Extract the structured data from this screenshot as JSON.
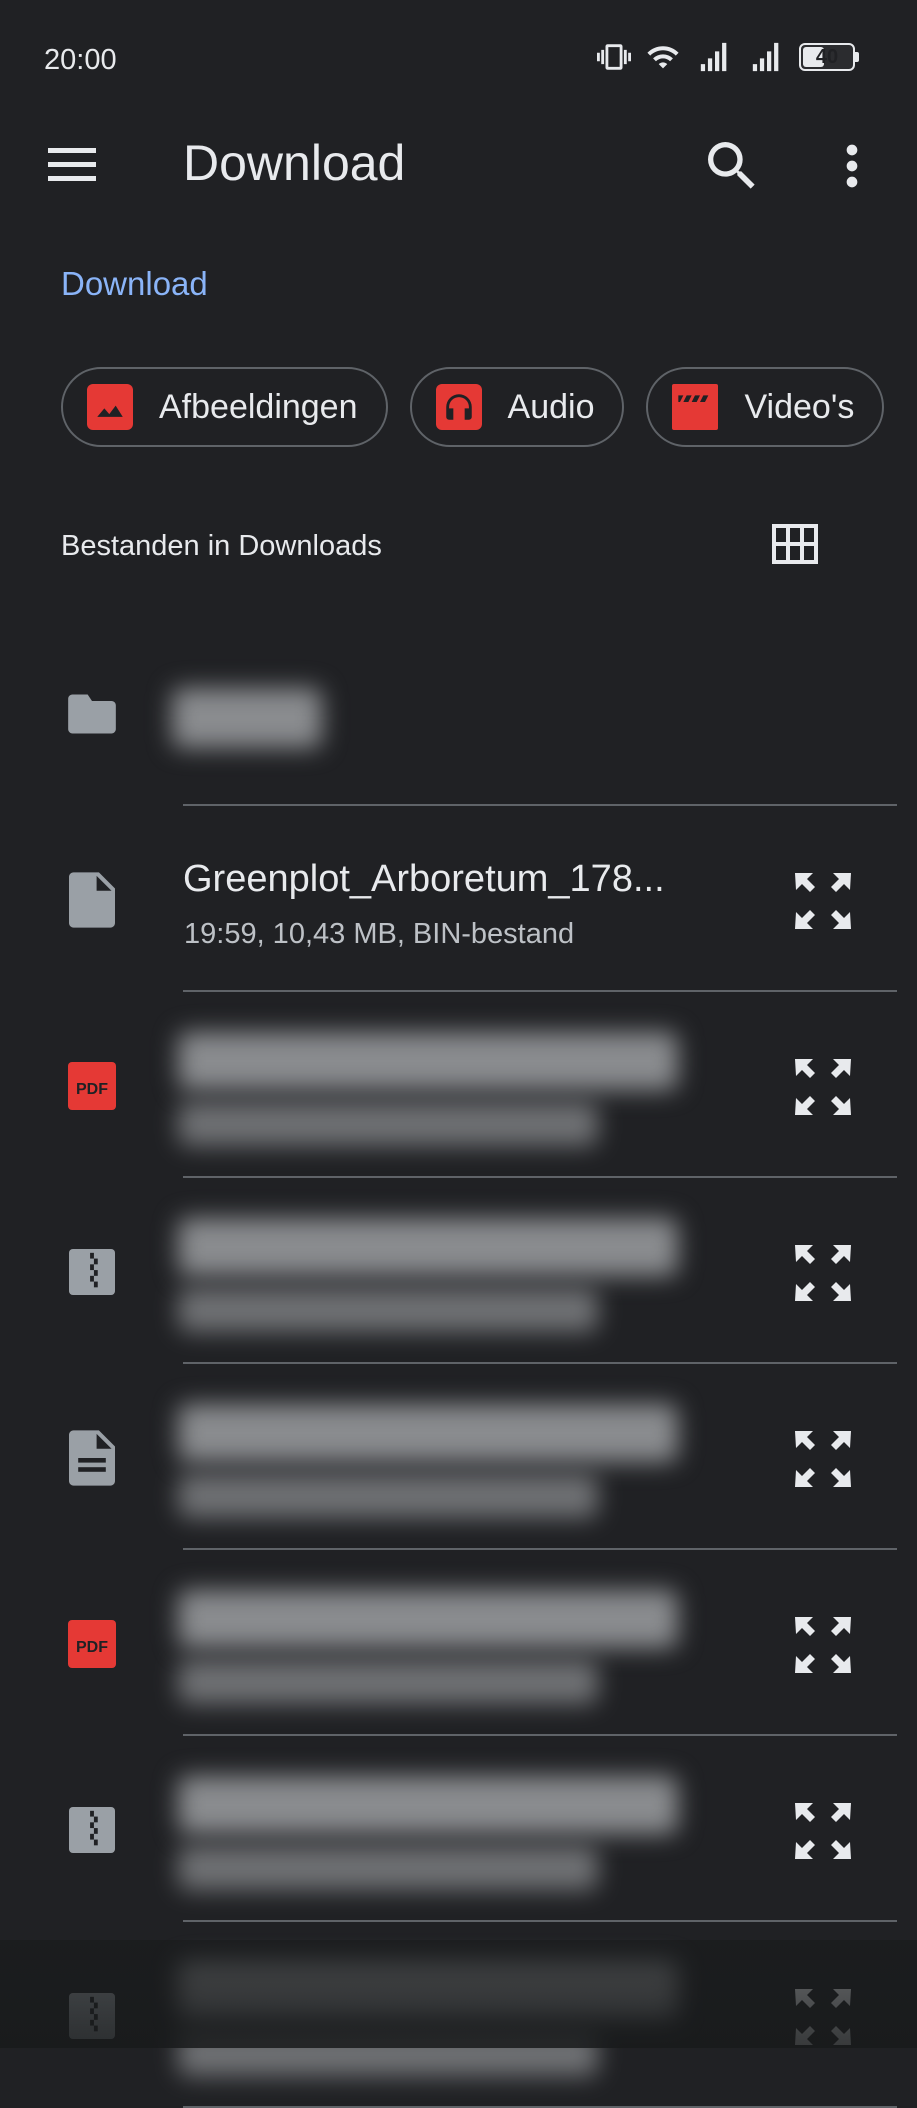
{
  "status_bar": {
    "time": "20:00",
    "battery": "40"
  },
  "app_bar": {
    "title": "Download"
  },
  "breadcrumb": "Download",
  "categories": [
    {
      "label": "Afbeeldingen",
      "icon": "image-icon"
    },
    {
      "label": "Audio",
      "icon": "headphones-icon"
    },
    {
      "label": "Video's",
      "icon": "clapperboard-icon"
    }
  ],
  "section": {
    "title": "Bestanden in Downloads"
  },
  "files": [
    {
      "type": "folder",
      "icon": "folder-icon",
      "name": "",
      "meta": "",
      "blurred": true
    },
    {
      "type": "bin",
      "icon": "file-icon",
      "name": "Greenplot_Arboretum_178...",
      "meta": "19:59, 10,43 MB, BIN-bestand",
      "blurred": false
    },
    {
      "type": "pdf",
      "icon": "pdf-icon",
      "name": "",
      "meta": "",
      "blurred": true
    },
    {
      "type": "zip",
      "icon": "zip-icon",
      "name": "",
      "meta": "",
      "blurred": true
    },
    {
      "type": "doc",
      "icon": "document-icon",
      "name": "",
      "meta": "",
      "blurred": true
    },
    {
      "type": "pdf",
      "icon": "pdf-icon",
      "name": "",
      "meta": "",
      "blurred": true
    },
    {
      "type": "zip",
      "icon": "zip-icon",
      "name": "",
      "meta": "",
      "blurred": true
    },
    {
      "type": "zip",
      "icon": "zip-icon",
      "name": "",
      "meta": "",
      "blurred": true
    }
  ],
  "colors": {
    "background": "#202124",
    "accent": "#8ab4f8",
    "category_icon": "#e53935",
    "pdf": "#e53935"
  }
}
